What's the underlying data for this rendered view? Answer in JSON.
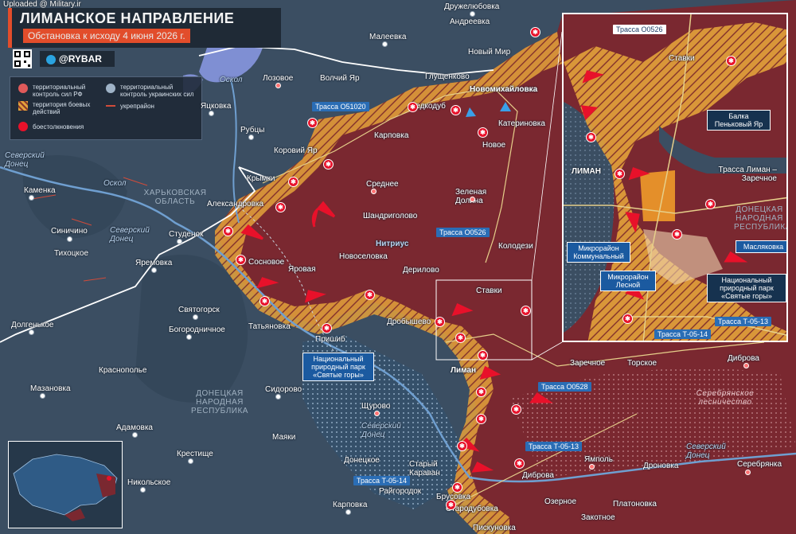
{
  "watermark": "Uploaded @ Military.ir",
  "header": {
    "title": "ЛИМАНСКОЕ НАПРАВЛЕНИЕ",
    "subtitle": "Обстановка к исходу 4 июня 2026 г.",
    "brand": "@RYBAR"
  },
  "legend": {
    "ru_control": "территориальный контроль сил РФ",
    "contested": "территория боевых действий",
    "ua_control": "территориальный контроль украинских сил",
    "fortified": "укрепрайон",
    "clashes": "боестолкновения"
  },
  "colors": {
    "ru_control": "#7a2830",
    "contested": "#e4a23a",
    "ua_control": "#3b5066",
    "clash": "#e8112a",
    "accent": "#e24d2b"
  },
  "towns": [
    {
      "name": "Дружелюбовка"
    },
    {
      "name": "Андреевка"
    },
    {
      "name": "Малеевка"
    },
    {
      "name": "Новый Мир"
    },
    {
      "name": "Лозовое"
    },
    {
      "name": "Волчий Яр"
    },
    {
      "name": "Глущенково"
    },
    {
      "name": "Яцковка"
    },
    {
      "name": "Новомихайловка"
    },
    {
      "name": "Редкодуб"
    },
    {
      "name": "Катериновка"
    },
    {
      "name": "Рубцы"
    },
    {
      "name": "Коровий Яр"
    },
    {
      "name": "Карповка"
    },
    {
      "name": "Новое"
    },
    {
      "name": "Крымки"
    },
    {
      "name": "Среднее"
    },
    {
      "name": "Зеленая Долина"
    },
    {
      "name": "Каменка"
    },
    {
      "name": "Александровка"
    },
    {
      "name": "Шандриголово"
    },
    {
      "name": "Синичино"
    },
    {
      "name": "Студенок"
    },
    {
      "name": "Нитриус"
    },
    {
      "name": "Колодези"
    },
    {
      "name": "Тихоцкое"
    },
    {
      "name": "Яремовка"
    },
    {
      "name": "Сосновое"
    },
    {
      "name": "Новоселовка"
    },
    {
      "name": "Яровая"
    },
    {
      "name": "Дерилово"
    },
    {
      "name": "Ставки"
    },
    {
      "name": "Святогорск"
    },
    {
      "name": "Долгенькое"
    },
    {
      "name": "Богородничное"
    },
    {
      "name": "Татьяновка"
    },
    {
      "name": "Дробышево"
    },
    {
      "name": "Пришиб"
    },
    {
      "name": "Краснополье"
    },
    {
      "name": "Лиман"
    },
    {
      "name": "Заречное"
    },
    {
      "name": "Торское"
    },
    {
      "name": "Диброва"
    },
    {
      "name": "Мазановка"
    },
    {
      "name": "Сидорово"
    },
    {
      "name": "Щурово"
    },
    {
      "name": "Адамовка"
    },
    {
      "name": "Маяки"
    },
    {
      "name": "Крестище"
    },
    {
      "name": "Ямполь"
    },
    {
      "name": "Дроновка"
    },
    {
      "name": "Серебрянка"
    },
    {
      "name": "Донецкое"
    },
    {
      "name": "Старый Караван"
    },
    {
      "name": "Никольское"
    },
    {
      "name": "Брусовка"
    },
    {
      "name": "Диброва"
    },
    {
      "name": "Райгородок"
    },
    {
      "name": "Стародубовка"
    },
    {
      "name": "Карповка"
    },
    {
      "name": "Озерное"
    },
    {
      "name": "Платоновка"
    },
    {
      "name": "Закотное"
    },
    {
      "name": "Пискуновка"
    }
  ],
  "regions": {
    "kharkov": "ХАРЬКОВСКАЯ ОБЛАСТЬ",
    "donetsk": "ДОНЕЦКАЯ НАРОДНАЯ РЕСПУБЛИКА",
    "forestry": "Серебрянское лесничество"
  },
  "rivers": {
    "oskol1": "Оскол",
    "oskol2": "Оскол",
    "donets1": "Северский Донец",
    "donets2": "Северский Донец",
    "donets3": "Северский Донец",
    "donets4": "Северский Донец"
  },
  "roads": {
    "r1": "Трасса О51020",
    "r2": "Трасса О0526",
    "r3": "Трасса О0528",
    "r4": "Трасса Т-05-13",
    "r5": "Трасса Т-05-14"
  },
  "park": "Национальный природный парк «Святые горы»",
  "inset": {
    "road_top": "Трасса О0526",
    "stavki": "Ставки",
    "balka": "Балка Пеньковый Яр",
    "liman": "ЛИМАН",
    "road_liman": "Трасса Лиман – Заречное",
    "dnr": "ДОНЕЦКАЯ НАРОДНАЯ РЕСПУБЛИКА",
    "komm": "Микрорайон Коммунальный",
    "masl": "Масляковка",
    "lesnoy": "Микрорайон Лесной",
    "park": "Национальный природный парк «Святые горы»",
    "t0513": "Трасса Т-05-13",
    "t0514": "Трасса Т-05-14"
  }
}
